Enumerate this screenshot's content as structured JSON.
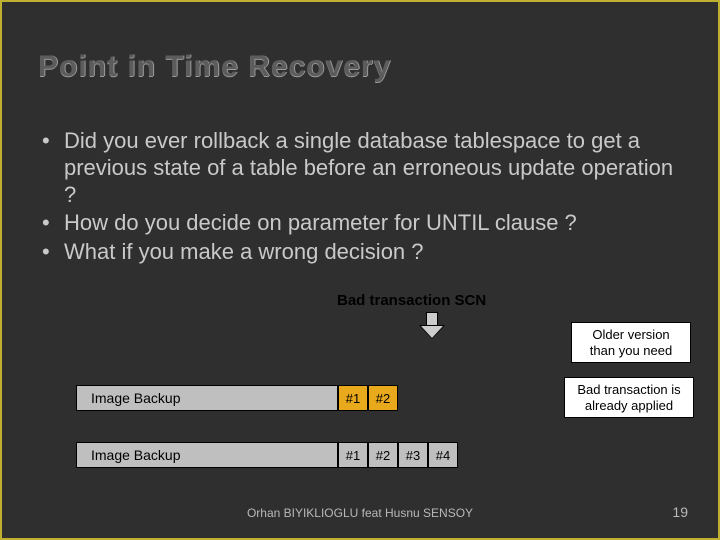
{
  "title": "Point in Time Recovery",
  "bullets": [
    "Did you ever rollback a single database tablespace to get a previous state of a table before an erroneous update operation ?",
    "How do you decide on parameter for UNTIL clause ?",
    "What if you make a wrong decision ?"
  ],
  "subheading": "Bad transaction SCN",
  "callouts": {
    "older_version": "Older version than you need",
    "already_applied": "Bad transaction is already applied"
  },
  "strips": {
    "backup_label": "Image Backup",
    "row1_segments": [
      "#1",
      "#2"
    ],
    "row2_segments": [
      "#1",
      "#2",
      "#3",
      "#4"
    ]
  },
  "footer": "Orhan BIYIKLIOGLU feat Husnu SENSOY",
  "page_number": "19"
}
